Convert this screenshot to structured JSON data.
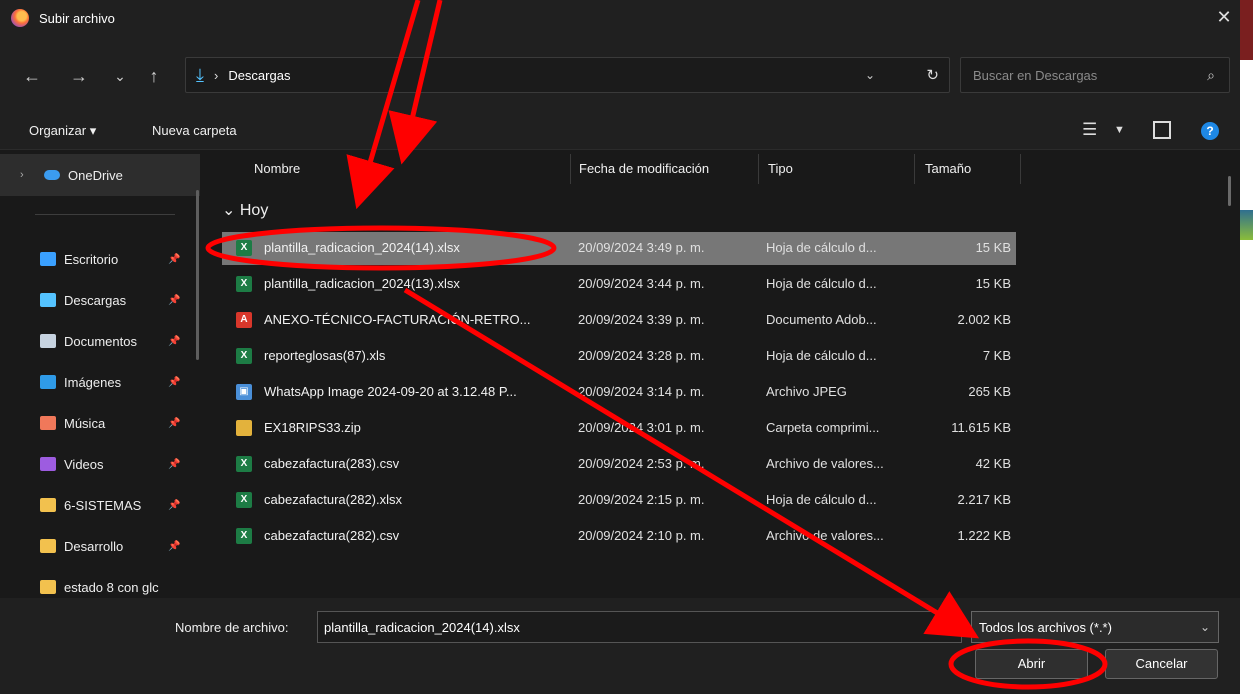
{
  "window": {
    "title": "Subir archivo",
    "close_glyph": "✕"
  },
  "nav": {
    "back_glyph": "←",
    "forward_glyph": "→",
    "recent_glyph": "⌄",
    "up_glyph": "↑",
    "address_sep": "›",
    "address_path": "Descargas",
    "search_placeholder": "Buscar en Descargas"
  },
  "toolbar": {
    "organize_label": "Organizar ▾",
    "new_folder_label": "Nueva carpeta"
  },
  "sidebar": {
    "onedrive": "OneDrive",
    "items": [
      {
        "label": "Escritorio",
        "icon": "desktop-icon",
        "color": "#3aa0ff"
      },
      {
        "label": "Descargas",
        "icon": "download-icon",
        "color": "#54c3ff"
      },
      {
        "label": "Documentos",
        "icon": "document-icon",
        "color": "#c7d3e0"
      },
      {
        "label": "Imágenes",
        "icon": "pictures-icon",
        "color": "#2f9be8"
      },
      {
        "label": "Música",
        "icon": "music-icon",
        "color": "#f0785a"
      },
      {
        "label": "Videos",
        "icon": "videos-icon",
        "color": "#9d5ce0"
      },
      {
        "label": "6-SISTEMAS",
        "icon": "folder-icon",
        "color": "#f2c14e"
      },
      {
        "label": "Desarrollo",
        "icon": "folder-icon",
        "color": "#f2c14e"
      },
      {
        "label": "estado 8 con glc",
        "icon": "folder-icon",
        "color": "#f2c14e"
      }
    ]
  },
  "columns": {
    "name": "Nombre",
    "date": "Fecha de modificación",
    "type": "Tipo",
    "size": "Tamaño"
  },
  "group": "Hoy",
  "files": [
    {
      "name": "plantilla_radicacion_2024(14).xlsx",
      "date": "20/09/2024 3:49 p. m.",
      "type": "Hoja de cálculo d...",
      "size": "15 KB",
      "icon": "excel-icon",
      "color": "#1d7c45",
      "glyph": "X",
      "selected": true
    },
    {
      "name": "plantilla_radicacion_2024(13).xlsx",
      "date": "20/09/2024 3:44 p. m.",
      "type": "Hoja de cálculo d...",
      "size": "15 KB",
      "icon": "excel-icon",
      "color": "#1d7c45",
      "glyph": "X"
    },
    {
      "name": "ANEXO-TÉCNICO-FACTURACIÓN-RETRO...",
      "date": "20/09/2024 3:39 p. m.",
      "type": "Documento Adob...",
      "size": "2.002 KB",
      "icon": "pdf-icon",
      "color": "#d9372b",
      "glyph": "A"
    },
    {
      "name": "reporteglosas(87).xls",
      "date": "20/09/2024 3:28 p. m.",
      "type": "Hoja de cálculo d...",
      "size": "7 KB",
      "icon": "excel-icon",
      "color": "#1d7c45",
      "glyph": "X"
    },
    {
      "name": "WhatsApp Image 2024-09-20 at 3.12.48 P...",
      "date": "20/09/2024 3:14 p. m.",
      "type": "Archivo JPEG",
      "size": "265 KB",
      "icon": "image-file-icon",
      "color": "#4a8fd8",
      "glyph": "▣"
    },
    {
      "name": "EX18RIPS33.zip",
      "date": "20/09/2024 3:01 p. m.",
      "type": "Carpeta comprimi...",
      "size": "11.615 KB",
      "icon": "zip-folder-icon",
      "color": "#e3b23c",
      "glyph": ""
    },
    {
      "name": "cabezafactura(283).csv",
      "date": "20/09/2024 2:53 p. m.",
      "type": "Archivo de valores...",
      "size": "42 KB",
      "icon": "excel-icon",
      "color": "#1d7c45",
      "glyph": "X"
    },
    {
      "name": "cabezafactura(282).xlsx",
      "date": "20/09/2024 2:15 p. m.",
      "type": "Hoja de cálculo d...",
      "size": "2.217 KB",
      "icon": "excel-icon",
      "color": "#1d7c45",
      "glyph": "X"
    },
    {
      "name": "cabezafactura(282).csv",
      "date": "20/09/2024 2:10 p. m.",
      "type": "Archivo de valores...",
      "size": "1.222 KB",
      "icon": "excel-icon",
      "color": "#1d7c45",
      "glyph": "X"
    }
  ],
  "footer": {
    "filename_label": "Nombre de archivo:",
    "filename_value": "plantilla_radicacion_2024(14).xlsx",
    "filter_value": "Todos los archivos (*.*)",
    "open_label": "Abrir",
    "cancel_label": "Cancelar"
  },
  "annotation_color": "#ff0000"
}
